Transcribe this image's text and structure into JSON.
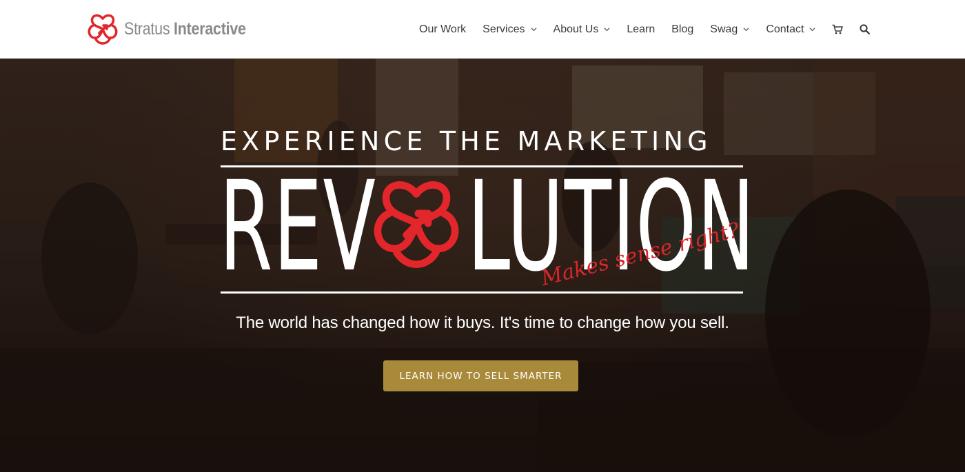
{
  "brand": {
    "name_light": "Stratus",
    "name_bold": "Interactive",
    "logo_icon": "stratus-knot-icon",
    "accent_color": "#e2262b",
    "text_color": "#8a8a8a"
  },
  "nav": {
    "items": [
      {
        "label": "Our Work",
        "dropdown": false
      },
      {
        "label": "Services",
        "dropdown": true
      },
      {
        "label": "About Us",
        "dropdown": true
      },
      {
        "label": "Learn",
        "dropdown": false
      },
      {
        "label": "Blog",
        "dropdown": false
      },
      {
        "label": "Swag",
        "dropdown": true
      },
      {
        "label": "Contact",
        "dropdown": true
      }
    ],
    "icons": [
      "cart-icon",
      "search-icon"
    ]
  },
  "hero": {
    "headline_top": "EXPERIENCE THE MARKETING",
    "big_word_left": "REV",
    "big_word_right": "LUTION",
    "tagline_script": "Makes sense right?",
    "subhead": "The world has changed how it buys. It's time to change how you sell.",
    "cta_label": "LEARN HOW TO SELL SMARTER",
    "cta_color": "#a88a3a"
  }
}
